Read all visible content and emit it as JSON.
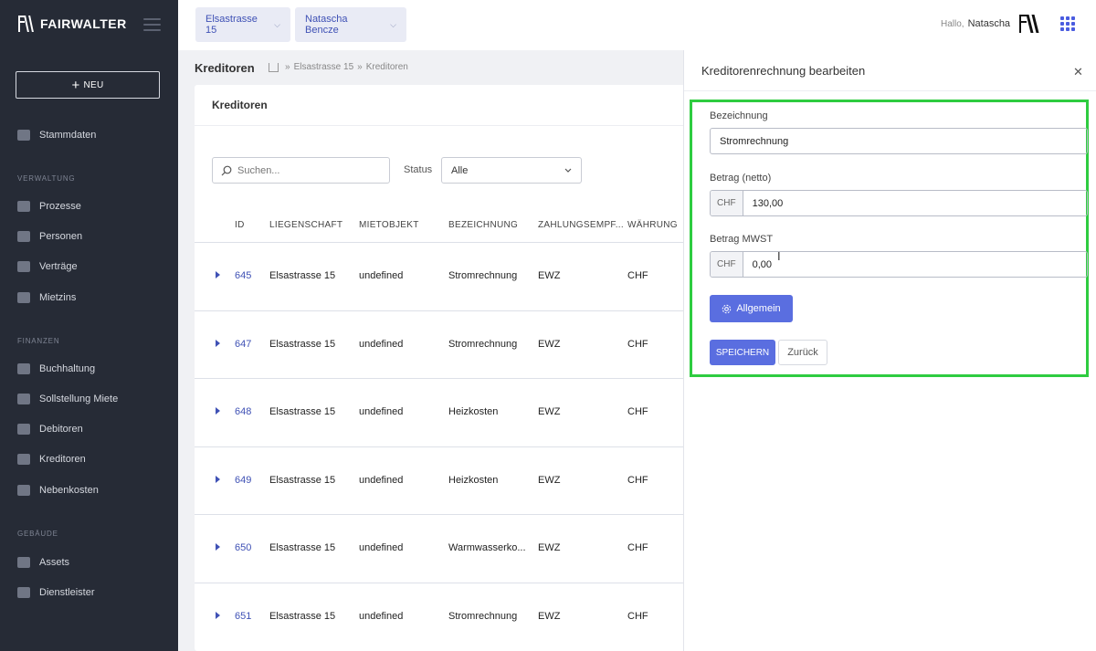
{
  "sidebar": {
    "logo": "FAIRWALTER",
    "new_label": "NEU",
    "items": [
      {
        "label": "Stammdaten",
        "icon": "database-icon"
      },
      {
        "section": "VERWALTUNG"
      },
      {
        "label": "Prozesse",
        "icon": "list-icon"
      },
      {
        "label": "Personen",
        "icon": "people-icon"
      },
      {
        "label": "Verträge",
        "icon": "contract-icon"
      },
      {
        "label": "Mietzins",
        "icon": "coins-icon"
      },
      {
        "section": "FINANZEN"
      },
      {
        "label": "Buchhaltung",
        "icon": "ledger-icon"
      },
      {
        "label": "Sollstellung Miete",
        "icon": "money-stack-icon"
      },
      {
        "label": "Debitoren",
        "icon": "money-stack-icon"
      },
      {
        "label": "Kreditoren",
        "icon": "money-stack-icon"
      },
      {
        "label": "Nebenkosten",
        "icon": "flame-icon"
      },
      {
        "section": "GEBÄUDE"
      },
      {
        "label": "Assets",
        "icon": "boxes-icon"
      },
      {
        "label": "Dienstleister",
        "icon": "worker-icon"
      }
    ]
  },
  "header": {
    "property_selector": "Elsastrasse 15",
    "person_selector": "Natascha Bencze",
    "greeting": "Hallo,",
    "user_name": "Natascha"
  },
  "main": {
    "page_title": "Kreditoren",
    "breadcrumb": [
      "Elsastrasse 15",
      "Kreditoren"
    ],
    "breadcrumb_sep": "»",
    "card_title": "Kreditoren",
    "search_placeholder": "Suchen...",
    "status_label": "Status",
    "status_value": "Alle",
    "columns": [
      "ID",
      "LIEGENSCHAFT",
      "MIETOBJEKT",
      "BEZEICHNUNG",
      "ZAHLUNGSEMPF...",
      "WÄHRUNG"
    ],
    "rows": [
      {
        "id": "645",
        "property": "Elsastrasse 15",
        "unit": "undefined",
        "desc": "Stromrechnung",
        "payee": "EWZ",
        "currency": "CHF"
      },
      {
        "id": "647",
        "property": "Elsastrasse 15",
        "unit": "undefined",
        "desc": "Stromrechnung",
        "payee": "EWZ",
        "currency": "CHF"
      },
      {
        "id": "648",
        "property": "Elsastrasse 15",
        "unit": "undefined",
        "desc": "Heizkosten",
        "payee": "EWZ",
        "currency": "CHF"
      },
      {
        "id": "649",
        "property": "Elsastrasse 15",
        "unit": "undefined",
        "desc": "Heizkosten",
        "payee": "EWZ",
        "currency": "CHF"
      },
      {
        "id": "650",
        "property": "Elsastrasse 15",
        "unit": "undefined",
        "desc": "Warmwasserko...",
        "payee": "EWZ",
        "currency": "CHF"
      },
      {
        "id": "651",
        "property": "Elsastrasse 15",
        "unit": "undefined",
        "desc": "Stromrechnung",
        "payee": "EWZ",
        "currency": "CHF"
      }
    ]
  },
  "drawer": {
    "title": "Kreditorenrechnung bearbeiten",
    "close_symbol": "✕",
    "desc_label": "Bezeichnung",
    "desc_value": "Stromrechnung",
    "net_label": "Betrag (netto)",
    "net_currency": "CHF",
    "net_value": "130,00",
    "vat_label": "Betrag MWST",
    "vat_currency": "CHF",
    "vat_value": "0,00",
    "general_button": "Allgemein",
    "save_button": "SPEICHERN",
    "back_button": "Zurück",
    "highlight_color": "#2ecc40"
  },
  "colors": {
    "sidebar_bg": "#262b36",
    "accent": "#5a6ee0",
    "link": "#3f51b5"
  }
}
